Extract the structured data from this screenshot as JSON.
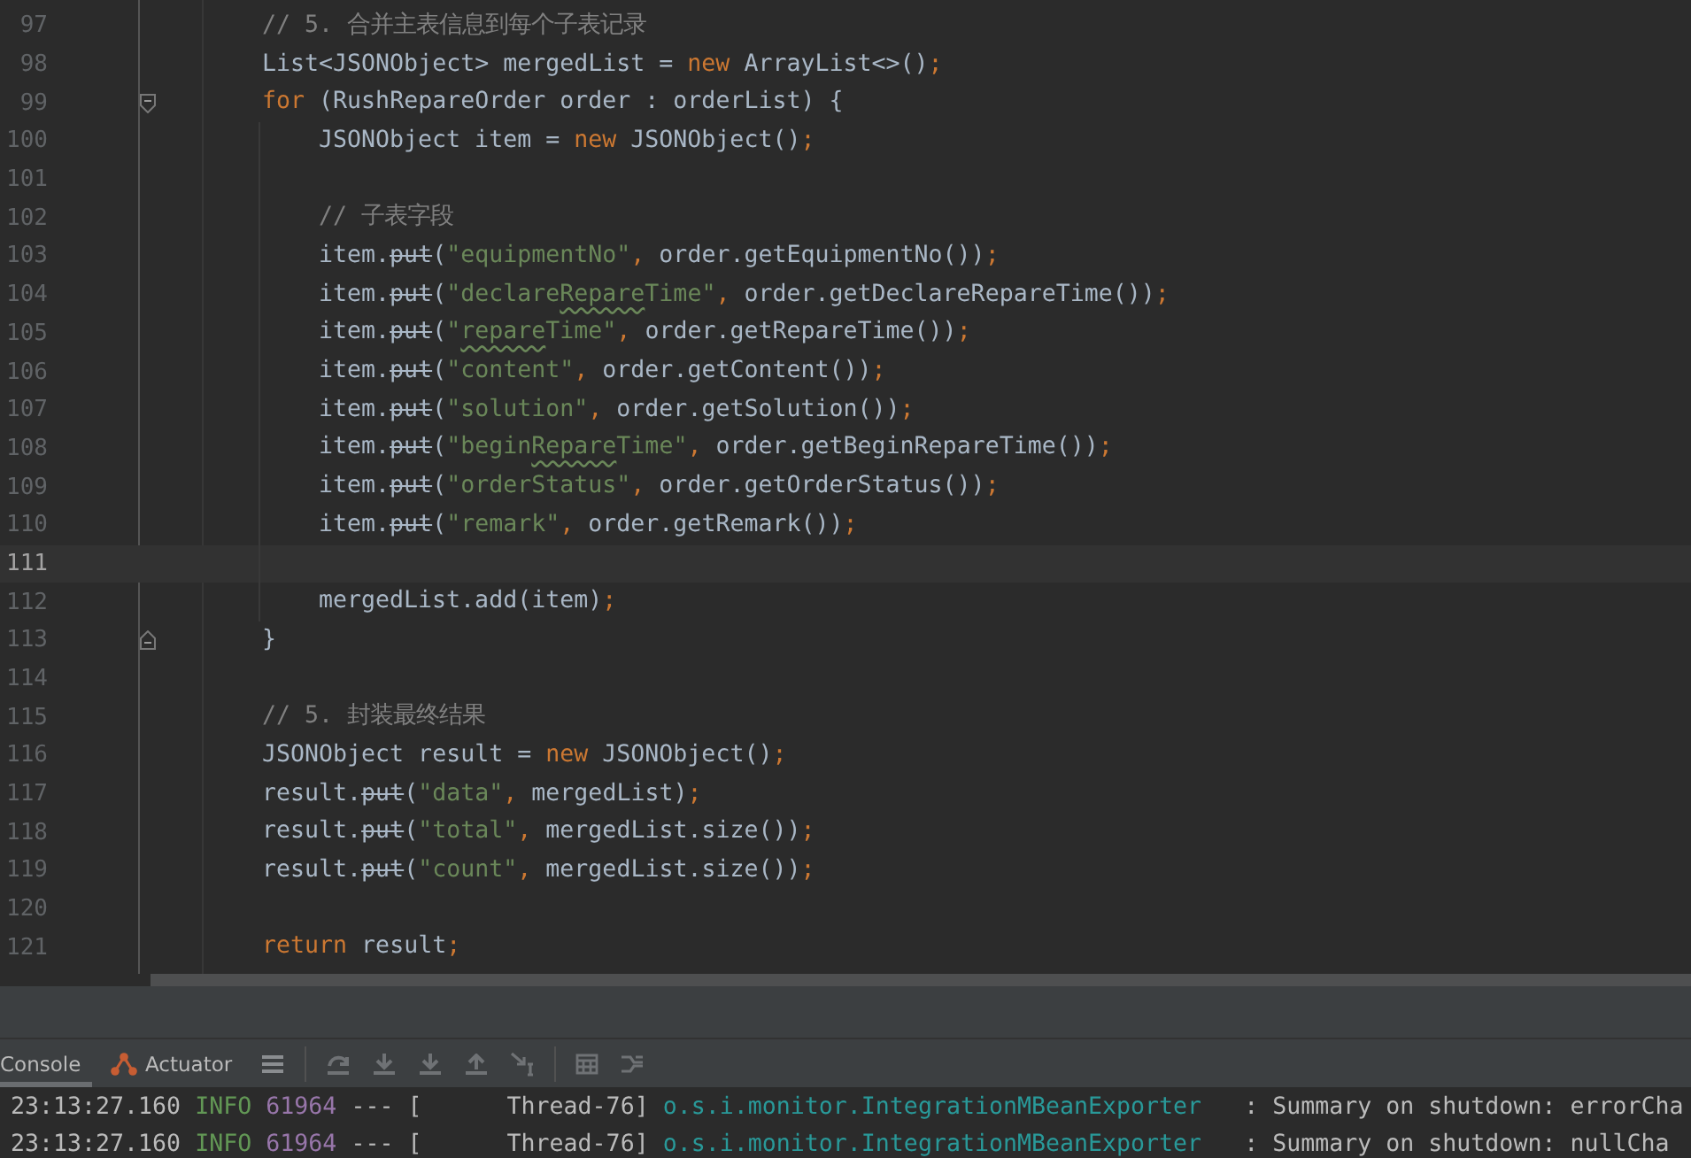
{
  "editor": {
    "lines": [
      {
        "number": "97",
        "current": false,
        "kind": "code",
        "tokens": [
          {
            "kind": "comment",
            "text": "// 5. 合并主表信息到每个子表记录"
          }
        ]
      },
      {
        "number": "98",
        "current": false,
        "kind": "code",
        "tokens": [
          {
            "kind": "plain",
            "text": "List<JSONObject> mergedList = "
          },
          {
            "kind": "keyword",
            "text": "new"
          },
          {
            "kind": "plain",
            "text": " ArrayList<>()"
          },
          {
            "kind": "punct",
            "text": ";"
          }
        ]
      },
      {
        "number": "99",
        "current": false,
        "kind": "fold_start",
        "tokens": [
          {
            "kind": "keyword",
            "text": "for"
          },
          {
            "kind": "plain",
            "text": " (RushRepareOrder order : orderList) {"
          }
        ],
        "children": [
          {
            "number": "100",
            "current": false,
            "kind": "code",
            "tokens": [
              {
                "kind": "plain",
                "text": "JSONObject item = "
              },
              {
                "kind": "keyword",
                "text": "new"
              },
              {
                "kind": "plain",
                "text": " JSONObject()"
              },
              {
                "kind": "punct",
                "text": ";"
              }
            ]
          },
          {
            "number": "101",
            "current": false,
            "kind": "code"
          },
          {
            "number": "102",
            "current": false,
            "kind": "code",
            "tokens": [
              {
                "kind": "comment",
                "text": "// 子表字段"
              }
            ]
          },
          {
            "number": "103",
            "current": false,
            "kind": "code",
            "tokens": [
              {
                "kind": "plain",
                "text": "item."
              },
              {
                "kind": "deprecated",
                "text": "put"
              },
              {
                "kind": "plain",
                "text": "("
              },
              {
                "kind": "string",
                "text": "\"equipmentNo\""
              },
              {
                "kind": "punct",
                "text": ","
              },
              {
                "kind": "plain",
                "text": " order.getEquipmentNo())"
              },
              {
                "kind": "punct",
                "text": ";"
              }
            ]
          },
          {
            "number": "104",
            "current": false,
            "kind": "code",
            "tokens": [
              {
                "kind": "plain",
                "text": "item."
              },
              {
                "kind": "deprecated",
                "text": "put"
              },
              {
                "kind": "plain",
                "text": "("
              },
              {
                "kind": "string",
                "text": "\"declare"
              },
              {
                "kind": "typo",
                "text": "Repare"
              },
              {
                "kind": "string",
                "text": "Time\""
              },
              {
                "kind": "punct",
                "text": ","
              },
              {
                "kind": "plain",
                "text": " order.getDeclareRepareTime())"
              },
              {
                "kind": "punct",
                "text": ";"
              }
            ]
          },
          {
            "number": "105",
            "current": false,
            "kind": "code",
            "tokens": [
              {
                "kind": "plain",
                "text": "item."
              },
              {
                "kind": "deprecated",
                "text": "put"
              },
              {
                "kind": "plain",
                "text": "("
              },
              {
                "kind": "string",
                "text": "\""
              },
              {
                "kind": "typo",
                "text": "repare"
              },
              {
                "kind": "string",
                "text": "Time\""
              },
              {
                "kind": "punct",
                "text": ","
              },
              {
                "kind": "plain",
                "text": " order.getRepareTime())"
              },
              {
                "kind": "punct",
                "text": ";"
              }
            ]
          },
          {
            "number": "106",
            "current": false,
            "kind": "code",
            "tokens": [
              {
                "kind": "plain",
                "text": "item."
              },
              {
                "kind": "deprecated",
                "text": "put"
              },
              {
                "kind": "plain",
                "text": "("
              },
              {
                "kind": "string",
                "text": "\"content\""
              },
              {
                "kind": "punct",
                "text": ","
              },
              {
                "kind": "plain",
                "text": " order.getContent())"
              },
              {
                "kind": "punct",
                "text": ";"
              }
            ]
          },
          {
            "number": "107",
            "current": false,
            "kind": "code",
            "tokens": [
              {
                "kind": "plain",
                "text": "item."
              },
              {
                "kind": "deprecated",
                "text": "put"
              },
              {
                "kind": "plain",
                "text": "("
              },
              {
                "kind": "string",
                "text": "\"solution\""
              },
              {
                "kind": "punct",
                "text": ","
              },
              {
                "kind": "plain",
                "text": " order.getSolution())"
              },
              {
                "kind": "punct",
                "text": ";"
              }
            ]
          },
          {
            "number": "108",
            "current": false,
            "kind": "code",
            "tokens": [
              {
                "kind": "plain",
                "text": "item."
              },
              {
                "kind": "deprecated",
                "text": "put"
              },
              {
                "kind": "plain",
                "text": "("
              },
              {
                "kind": "string",
                "text": "\"begin"
              },
              {
                "kind": "typo",
                "text": "Repare"
              },
              {
                "kind": "string",
                "text": "Time\""
              },
              {
                "kind": "punct",
                "text": ","
              },
              {
                "kind": "plain",
                "text": " order.getBeginRepareTime())"
              },
              {
                "kind": "punct",
                "text": ";"
              }
            ]
          },
          {
            "number": "109",
            "current": false,
            "kind": "code",
            "tokens": [
              {
                "kind": "plain",
                "text": "item."
              },
              {
                "kind": "deprecated",
                "text": "put"
              },
              {
                "kind": "plain",
                "text": "("
              },
              {
                "kind": "string",
                "text": "\"orderStatus\""
              },
              {
                "kind": "punct",
                "text": ","
              },
              {
                "kind": "plain",
                "text": " order.getOrderStatus())"
              },
              {
                "kind": "punct",
                "text": ";"
              }
            ]
          },
          {
            "number": "110",
            "current": false,
            "kind": "code",
            "tokens": [
              {
                "kind": "plain",
                "text": "item."
              },
              {
                "kind": "deprecated",
                "text": "put"
              },
              {
                "kind": "plain",
                "text": "("
              },
              {
                "kind": "string",
                "text": "\"remark\""
              },
              {
                "kind": "punct",
                "text": ","
              },
              {
                "kind": "plain",
                "text": " order.getRemark())"
              },
              {
                "kind": "punct",
                "text": ";"
              }
            ]
          },
          {
            "number": "111",
            "current": true,
            "kind": "code"
          },
          {
            "number": "112",
            "current": false,
            "kind": "code",
            "tokens": [
              {
                "kind": "plain",
                "text": "mergedList.add(item)"
              },
              {
                "kind": "punct",
                "text": ";"
              }
            ]
          }
        ]
      },
      {
        "number": "113",
        "current": false,
        "kind": "fold_end",
        "tokens": [
          {
            "kind": "plain",
            "text": "}"
          }
        ]
      },
      {
        "number": "114",
        "current": false,
        "kind": "code"
      },
      {
        "number": "115",
        "current": false,
        "kind": "code",
        "tokens": [
          {
            "kind": "comment",
            "text": "// 5. 封装最终结果"
          }
        ]
      },
      {
        "number": "116",
        "current": false,
        "kind": "code",
        "tokens": [
          {
            "kind": "plain",
            "text": "JSONObject result = "
          },
          {
            "kind": "keyword",
            "text": "new"
          },
          {
            "kind": "plain",
            "text": " JSONObject()"
          },
          {
            "kind": "punct",
            "text": ";"
          }
        ]
      },
      {
        "number": "117",
        "current": false,
        "kind": "code",
        "tokens": [
          {
            "kind": "plain",
            "text": "result."
          },
          {
            "kind": "deprecated",
            "text": "put"
          },
          {
            "kind": "plain",
            "text": "("
          },
          {
            "kind": "string",
            "text": "\"data\""
          },
          {
            "kind": "punct",
            "text": ","
          },
          {
            "kind": "plain",
            "text": " mergedList)"
          },
          {
            "kind": "punct",
            "text": ";"
          }
        ]
      },
      {
        "number": "118",
        "current": false,
        "kind": "code",
        "tokens": [
          {
            "kind": "plain",
            "text": "result."
          },
          {
            "kind": "deprecated",
            "text": "put"
          },
          {
            "kind": "plain",
            "text": "("
          },
          {
            "kind": "string",
            "text": "\"total\""
          },
          {
            "kind": "punct",
            "text": ","
          },
          {
            "kind": "plain",
            "text": " mergedList.size())"
          },
          {
            "kind": "punct",
            "text": ";"
          }
        ]
      },
      {
        "number": "119",
        "current": false,
        "kind": "code",
        "tokens": [
          {
            "kind": "plain",
            "text": "result."
          },
          {
            "kind": "deprecated",
            "text": "put"
          },
          {
            "kind": "plain",
            "text": "("
          },
          {
            "kind": "string",
            "text": "\"count\""
          },
          {
            "kind": "punct",
            "text": ","
          },
          {
            "kind": "plain",
            "text": " mergedList.size())"
          },
          {
            "kind": "punct",
            "text": ";"
          }
        ]
      },
      {
        "number": "120",
        "current": false,
        "kind": "code"
      },
      {
        "number": "121",
        "current": false,
        "kind": "code",
        "tokens": [
          {
            "kind": "keyword",
            "text": "return"
          },
          {
            "kind": "plain",
            "text": " result"
          },
          {
            "kind": "punct",
            "text": ";"
          }
        ]
      }
    ]
  },
  "tool_window": {
    "tabs": [
      {
        "label": "Console",
        "selected": true,
        "kind": "text"
      },
      {
        "label": "Actuator",
        "selected": false,
        "kind": "actuator"
      }
    ],
    "log": [
      {
        "time": "23:13:27.160",
        "level": "INFO",
        "pid": "61964",
        "separator": "---",
        "thread": "[      Thread-76]",
        "logger": "o.s.i.monitor.IntegrationMBeanExporter",
        "message": "  : Summary on shutdown: errorCha"
      },
      {
        "time": "23:13:27.160",
        "level": "INFO",
        "pid": "61964",
        "separator": "---",
        "thread": "[      Thread-76]",
        "logger": "o.s.i.monitor.IntegrationMBeanExporter",
        "message": "  : Summary on shutdown: nullCha"
      }
    ]
  }
}
